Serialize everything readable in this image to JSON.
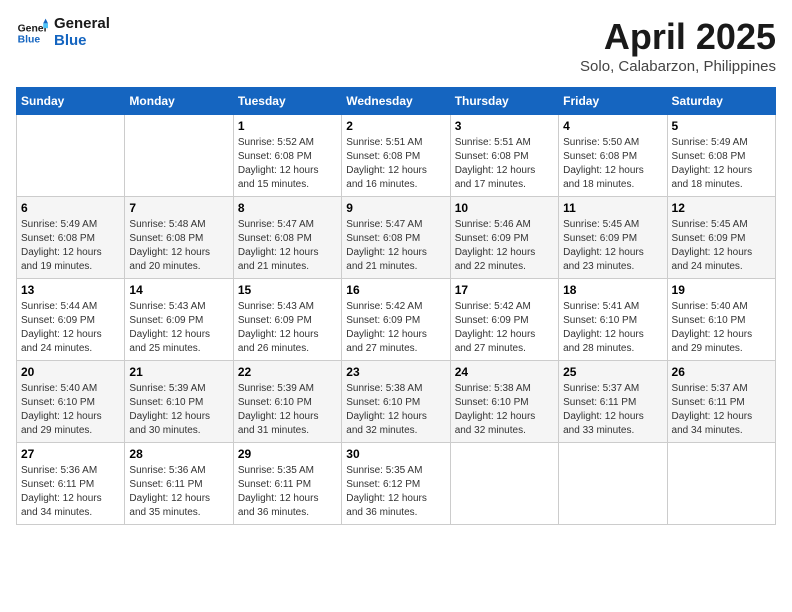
{
  "header": {
    "logo_line1": "General",
    "logo_line2": "Blue",
    "title": "April 2025",
    "subtitle": "Solo, Calabarzon, Philippines"
  },
  "weekdays": [
    "Sunday",
    "Monday",
    "Tuesday",
    "Wednesday",
    "Thursday",
    "Friday",
    "Saturday"
  ],
  "weeks": [
    [
      {
        "day": "",
        "sunrise": "",
        "sunset": "",
        "daylight": ""
      },
      {
        "day": "",
        "sunrise": "",
        "sunset": "",
        "daylight": ""
      },
      {
        "day": "1",
        "sunrise": "Sunrise: 5:52 AM",
        "sunset": "Sunset: 6:08 PM",
        "daylight": "Daylight: 12 hours and 15 minutes."
      },
      {
        "day": "2",
        "sunrise": "Sunrise: 5:51 AM",
        "sunset": "Sunset: 6:08 PM",
        "daylight": "Daylight: 12 hours and 16 minutes."
      },
      {
        "day": "3",
        "sunrise": "Sunrise: 5:51 AM",
        "sunset": "Sunset: 6:08 PM",
        "daylight": "Daylight: 12 hours and 17 minutes."
      },
      {
        "day": "4",
        "sunrise": "Sunrise: 5:50 AM",
        "sunset": "Sunset: 6:08 PM",
        "daylight": "Daylight: 12 hours and 18 minutes."
      },
      {
        "day": "5",
        "sunrise": "Sunrise: 5:49 AM",
        "sunset": "Sunset: 6:08 PM",
        "daylight": "Daylight: 12 hours and 18 minutes."
      }
    ],
    [
      {
        "day": "6",
        "sunrise": "Sunrise: 5:49 AM",
        "sunset": "Sunset: 6:08 PM",
        "daylight": "Daylight: 12 hours and 19 minutes."
      },
      {
        "day": "7",
        "sunrise": "Sunrise: 5:48 AM",
        "sunset": "Sunset: 6:08 PM",
        "daylight": "Daylight: 12 hours and 20 minutes."
      },
      {
        "day": "8",
        "sunrise": "Sunrise: 5:47 AM",
        "sunset": "Sunset: 6:08 PM",
        "daylight": "Daylight: 12 hours and 21 minutes."
      },
      {
        "day": "9",
        "sunrise": "Sunrise: 5:47 AM",
        "sunset": "Sunset: 6:08 PM",
        "daylight": "Daylight: 12 hours and 21 minutes."
      },
      {
        "day": "10",
        "sunrise": "Sunrise: 5:46 AM",
        "sunset": "Sunset: 6:09 PM",
        "daylight": "Daylight: 12 hours and 22 minutes."
      },
      {
        "day": "11",
        "sunrise": "Sunrise: 5:45 AM",
        "sunset": "Sunset: 6:09 PM",
        "daylight": "Daylight: 12 hours and 23 minutes."
      },
      {
        "day": "12",
        "sunrise": "Sunrise: 5:45 AM",
        "sunset": "Sunset: 6:09 PM",
        "daylight": "Daylight: 12 hours and 24 minutes."
      }
    ],
    [
      {
        "day": "13",
        "sunrise": "Sunrise: 5:44 AM",
        "sunset": "Sunset: 6:09 PM",
        "daylight": "Daylight: 12 hours and 24 minutes."
      },
      {
        "day": "14",
        "sunrise": "Sunrise: 5:43 AM",
        "sunset": "Sunset: 6:09 PM",
        "daylight": "Daylight: 12 hours and 25 minutes."
      },
      {
        "day": "15",
        "sunrise": "Sunrise: 5:43 AM",
        "sunset": "Sunset: 6:09 PM",
        "daylight": "Daylight: 12 hours and 26 minutes."
      },
      {
        "day": "16",
        "sunrise": "Sunrise: 5:42 AM",
        "sunset": "Sunset: 6:09 PM",
        "daylight": "Daylight: 12 hours and 27 minutes."
      },
      {
        "day": "17",
        "sunrise": "Sunrise: 5:42 AM",
        "sunset": "Sunset: 6:09 PM",
        "daylight": "Daylight: 12 hours and 27 minutes."
      },
      {
        "day": "18",
        "sunrise": "Sunrise: 5:41 AM",
        "sunset": "Sunset: 6:10 PM",
        "daylight": "Daylight: 12 hours and 28 minutes."
      },
      {
        "day": "19",
        "sunrise": "Sunrise: 5:40 AM",
        "sunset": "Sunset: 6:10 PM",
        "daylight": "Daylight: 12 hours and 29 minutes."
      }
    ],
    [
      {
        "day": "20",
        "sunrise": "Sunrise: 5:40 AM",
        "sunset": "Sunset: 6:10 PM",
        "daylight": "Daylight: 12 hours and 29 minutes."
      },
      {
        "day": "21",
        "sunrise": "Sunrise: 5:39 AM",
        "sunset": "Sunset: 6:10 PM",
        "daylight": "Daylight: 12 hours and 30 minutes."
      },
      {
        "day": "22",
        "sunrise": "Sunrise: 5:39 AM",
        "sunset": "Sunset: 6:10 PM",
        "daylight": "Daylight: 12 hours and 31 minutes."
      },
      {
        "day": "23",
        "sunrise": "Sunrise: 5:38 AM",
        "sunset": "Sunset: 6:10 PM",
        "daylight": "Daylight: 12 hours and 32 minutes."
      },
      {
        "day": "24",
        "sunrise": "Sunrise: 5:38 AM",
        "sunset": "Sunset: 6:10 PM",
        "daylight": "Daylight: 12 hours and 32 minutes."
      },
      {
        "day": "25",
        "sunrise": "Sunrise: 5:37 AM",
        "sunset": "Sunset: 6:11 PM",
        "daylight": "Daylight: 12 hours and 33 minutes."
      },
      {
        "day": "26",
        "sunrise": "Sunrise: 5:37 AM",
        "sunset": "Sunset: 6:11 PM",
        "daylight": "Daylight: 12 hours and 34 minutes."
      }
    ],
    [
      {
        "day": "27",
        "sunrise": "Sunrise: 5:36 AM",
        "sunset": "Sunset: 6:11 PM",
        "daylight": "Daylight: 12 hours and 34 minutes."
      },
      {
        "day": "28",
        "sunrise": "Sunrise: 5:36 AM",
        "sunset": "Sunset: 6:11 PM",
        "daylight": "Daylight: 12 hours and 35 minutes."
      },
      {
        "day": "29",
        "sunrise": "Sunrise: 5:35 AM",
        "sunset": "Sunset: 6:11 PM",
        "daylight": "Daylight: 12 hours and 36 minutes."
      },
      {
        "day": "30",
        "sunrise": "Sunrise: 5:35 AM",
        "sunset": "Sunset: 6:12 PM",
        "daylight": "Daylight: 12 hours and 36 minutes."
      },
      {
        "day": "",
        "sunrise": "",
        "sunset": "",
        "daylight": ""
      },
      {
        "day": "",
        "sunrise": "",
        "sunset": "",
        "daylight": ""
      },
      {
        "day": "",
        "sunrise": "",
        "sunset": "",
        "daylight": ""
      }
    ]
  ]
}
